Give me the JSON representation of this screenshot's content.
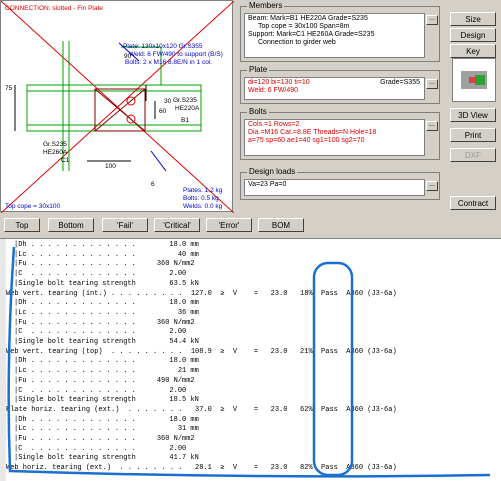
{
  "drawing": {
    "connection": "CONNECTION: slotted - Fin Plate",
    "plate": "Plate: 130x10x120 Gr.S355",
    "weld": "Weld: 6 FW/490 to support (B/S)",
    "bolts": "Bolts: 2 x M16 8.8E/N in 1 col.",
    "dim_75": "75",
    "dim_30": "30",
    "dim_60": "60",
    "dim_90": "90",
    "dim_100": "100",
    "dim_6": "6",
    "beam_grade": "Gr.S235",
    "beam_section": "HE220A",
    "beam_mark": "B1",
    "col_grade": "Gr.S235",
    "col_section": "HE260A",
    "col_mark": "C1",
    "weight_plates": "Plates: 1.2 kg",
    "weight_bolts": "Bolts: 0.5 kg",
    "weight_welds": "Welds: 0.0 kg",
    "top_cope": "Top cope = 30x100"
  },
  "members": {
    "title": "Members",
    "line1": "Beam: Mark=B1  HE220A  Grade=S235",
    "line2": "Top cope = 30x100  Span=8m",
    "line3": "Support: Mark=C1  HE260A  Grade=S235",
    "line4": "Connection to girder web"
  },
  "plate": {
    "title": "Plate",
    "line1": "di=120  bi=130  ti=10",
    "grade": "Grade=S355",
    "line2": "Weld: 6 FW/490"
  },
  "bolts": {
    "title": "Bolts",
    "line1": "Cols.=1  Rows=2",
    "line2": "Dia.=M16 Cat.=8.8E Threads=N Hole=18",
    "line3": "a=75  sp=60  ae1=40  sg1=100  sg2=70"
  },
  "loads": {
    "title": "Design loads",
    "line1": "Va=23  Pa=0"
  },
  "ellipsis": "...",
  "side_buttons": {
    "size": "Size",
    "design": "Design",
    "key_diagram": "Key Diagram",
    "view3d": "3D View",
    "print": "Print",
    "dxf": "DXF",
    "contract": "Contract"
  },
  "bottom_buttons": {
    "top": "Top",
    "bottom": "Bottom",
    "fail": "'Fail'",
    "critical": "'Critical'",
    "error": "'Error'",
    "bom": "BOM"
  },
  "report_lines": [
    "|Dh . . . . . . . . . . . . .        18.0 mm",
    "|Lc . . . . . . . . . . . . .          40 mm",
    "|Fu . . . . . . . . . . . . .     360 N/mm2",
    "|C  . . . . . . . . . . . . .        2.00",
    "|Single bolt tearing strength        63.5 kN",
    "Web vert. tearing (int.) . . . . . . . . .  127.0  ≥  V    =   23.0   18%  Pass  A360 (J3-6a)",
    "|Dh . . . . . . . . . . . . .        18.0 mm",
    "|Lc . . . . . . . . . . . . .          36 mm",
    "|Fu . . . . . . . . . . . . .     360 N/mm2",
    "|C  . . . . . . . . . . . . .        2.00",
    "|Single bolt tearing strength        54.4 kN",
    "Web vert. tearing (top)  . . . . . . . . .  108.9  ≥  V    =   23.0   21%  Pass  A360 (J3-6a)",
    "|Dh . . . . . . . . . . . . .        18.0 mm",
    "|Lc . . . . . . . . . . . . .          21 mm",
    "|Fu . . . . . . . . . . . . .     490 N/mm2",
    "|C  . . . . . . . . . . . . .        2.00",
    "|Single bolt tearing strength        18.5 kN",
    "Plate horiz. tearing (ext.)  . . . . . . .   37.0  ≥  V    =   23.0   62%  Pass  A360 (J3-6a)",
    "|Dh . . . . . . . . . . . . .        18.0 mm",
    "|Lc . . . . . . . . . . . . .          31 mm",
    "|Fu . . . . . . . . . . . . .     360 N/mm2",
    "|C  . . . . . . . . . . . . .        2.00",
    "|Single bolt tearing strength        41.7 kN",
    "Web horiz. tearing (ext.)  . . . . . . . .   28.1  ≥  V    =   23.0   82%  Pass  A360 (J3-6a)"
  ]
}
